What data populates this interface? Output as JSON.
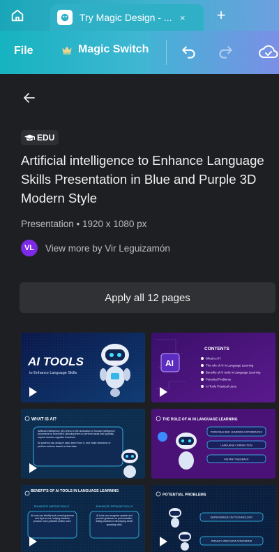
{
  "browser": {
    "tab_title": "Try Magic Design - ...",
    "tab_close": "×",
    "new_tab": "+"
  },
  "toolbar": {
    "file_label": "File",
    "magic_switch_label": "Magic Switch"
  },
  "panel": {
    "badge": "EDU",
    "title": "Artificial intelligence to Enhance Language Skills Presentation in Blue and Purple 3D Modern Style",
    "meta": "Presentation • 1920 x 1080 px",
    "author_initials": "VL",
    "author_text": "View more by Vir Leguizamón",
    "apply_label": "Apply all 12 pages"
  },
  "thumbnails": [
    {
      "heading": "AI TOOLS",
      "subheading": "to Enhance Language Skills"
    },
    {
      "heading": "CONTENTS",
      "badge": "AI",
      "items": [
        "What is AI?",
        "The role of AI in Language Learning",
        "Benefits of AI tools in Language Learning",
        "Potential Problems",
        "AI Tools Practical Uses"
      ]
    },
    {
      "heading": "WHAT IS AI?",
      "para1": "Artificial Intelligence (AI) refers to the simulation of human intelligence processes by machines, allowing them to perform tasks that typically require human cognitive functions.",
      "para2": "AI systems can analyze data, learn from it, and make decisions or perform actions based on that data."
    },
    {
      "heading": "THE ROLE OF AI IN LANGUAGE LEARNING",
      "items": [
        "PERSONALISED LEARNING EXPERIENCES",
        "LANGUAGE CORRECTION",
        "INSTANT FEEDBACK"
      ]
    },
    {
      "heading": "BENEFITS OF AI TOOLS IN LANGUAGE LEARNING",
      "col1_title": "ENHANCED WRITING SKILLS",
      "col1_text": "AI tools can identify and correct grammar and style errors, helping students produce more polished written work.",
      "col2_title": "ENHANCED SPEAKING SKILLS",
      "col2_text": "AI tools can recognize speech and provide guidance on pronunciation, aiding students in developing better speaking skills."
    },
    {
      "heading": "POTENTIAL PROBLEMS",
      "items": [
        "DEPENDENCE ON TECHNOLOGY",
        "PRIVACY AND DATA CONCERNS"
      ]
    }
  ],
  "colors": {
    "accent_purple": "#7d2ae8",
    "toolbar_teal": "#16b3c0",
    "panel_bg": "#1e1f22",
    "button_bg": "#303134"
  }
}
